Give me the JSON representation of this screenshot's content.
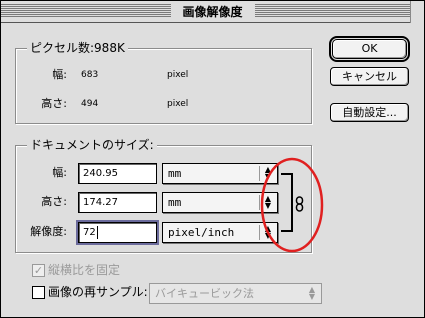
{
  "window": {
    "title": "画像解像度"
  },
  "pixel_dimensions": {
    "label": "ピクセル数:988K",
    "width_label": "幅:",
    "width_value": "683",
    "width_unit": "pixel",
    "height_label": "高さ:",
    "height_value": "494",
    "height_unit": "pixel"
  },
  "document_size": {
    "label": "ドキュメントのサイズ:",
    "width_label": "幅:",
    "width_value": "240.95",
    "width_unit": "mm",
    "height_label": "高さ:",
    "height_value": "174.27",
    "height_unit": "mm",
    "resolution_label": "解像度:",
    "resolution_value": "72",
    "resolution_unit": "pixel/inch"
  },
  "buttons": {
    "ok": "OK",
    "cancel": "キャンセル",
    "auto": "自動設定..."
  },
  "options": {
    "constrain_label": "縦横比を固定",
    "constrain_checked": true,
    "resample_label": "画像の再サンプル:",
    "resample_checked": false,
    "resample_method": "バイキュービック法"
  },
  "annotation": {
    "color": "#e02020",
    "shape": "red-circle"
  }
}
